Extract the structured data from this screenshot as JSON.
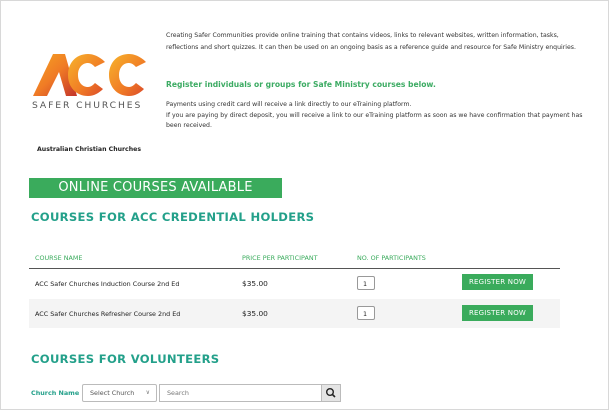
{
  "logo": {
    "text": "ACC",
    "subtitle": "SAFER CHURCHES",
    "org_name": "Australian Christian Churches"
  },
  "intro": {
    "paragraph": "Creating Safer Communities provide online training that contains videos, links to relevant websites, written information, tasks, reflections and short quizzes. It can then be used on an ongoing basis as a reference guide and resource for Safe Ministry enquiries.",
    "register_heading": "Register individuals or groups for Safe Ministry courses below.",
    "payment_line1": "Payments using credit card will receive a link directly to our eTraining platform.",
    "payment_line2": "If you are paying by direct deposit, you will receive a link to our eTraining platform as soon as we have confirmation that payment has been received."
  },
  "banner": {
    "label": "ONLINE COURSES AVAILABLE"
  },
  "credential_section": {
    "heading": "COURSES FOR ACC CREDENTIAL HOLDERS",
    "columns": [
      "COURSE NAME",
      "PRICE PER PARTICIPANT",
      "NO. OF PARTICIPANTS"
    ],
    "rows": [
      {
        "name": "ACC Safer Churches Induction Course 2nd Ed",
        "price": "$35.00",
        "qty": "1",
        "button": "REGISTER NOW"
      },
      {
        "name": "ACC Safer Churches Refresher Course 2nd Ed",
        "price": "$35.00",
        "qty": "1",
        "button": "REGISTER NOW"
      }
    ]
  },
  "volunteer_section": {
    "heading": "COURSES FOR VOLUNTEERS",
    "church_label": "Church Name",
    "church_select_value": "Select Church",
    "search_placeholder": "Search"
  },
  "colors": {
    "brand_green": "#3aab5c",
    "heading_teal": "#23a08a",
    "logo_orange": "#f07b25",
    "logo_red": "#c2332b",
    "logo_yellow": "#f5a623"
  },
  "icons": {
    "search_button": "search-icon",
    "select_chevron": "chevron-down-icon"
  }
}
